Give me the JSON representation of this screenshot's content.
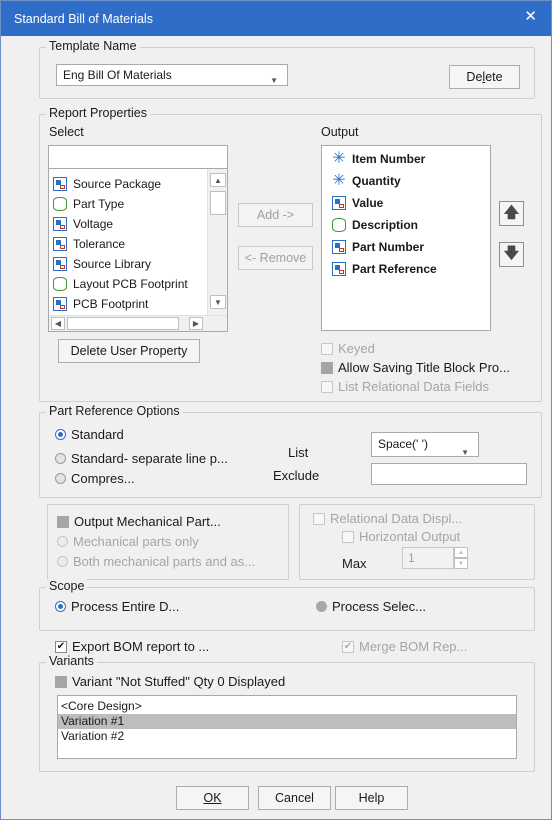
{
  "window": {
    "title": "Standard Bill of Materials",
    "close_icon": "close-icon"
  },
  "template": {
    "group_label": "Template Name",
    "selected": "Eng Bill Of Materials",
    "delete_label_pre": "De",
    "delete_label_u": "l",
    "delete_label_post": "ete"
  },
  "report_properties": {
    "group_label": "Report Properties",
    "select_label": "Select",
    "output_label": "Output",
    "select_items": [
      {
        "label": "Source Package",
        "icon": "property-icon"
      },
      {
        "label": "Part Type",
        "icon": "cylinder-icon"
      },
      {
        "label": "Voltage",
        "icon": "property-icon"
      },
      {
        "label": "Tolerance",
        "icon": "property-icon"
      },
      {
        "label": "Source Library",
        "icon": "property-icon"
      },
      {
        "label": "Layout PCB Footprint",
        "icon": "cylinder-icon"
      },
      {
        "label": "PCB Footprint",
        "icon": "property-icon"
      }
    ],
    "output_items": [
      {
        "label": "Item Number",
        "icon": "asterisk-icon"
      },
      {
        "label": "Quantity",
        "icon": "asterisk-icon"
      },
      {
        "label": "Value",
        "icon": "property-icon"
      },
      {
        "label": "Description",
        "icon": "cylinder-icon"
      },
      {
        "label": "Part Number",
        "icon": "property-icon"
      },
      {
        "label": "Part Reference",
        "icon": "property-icon"
      }
    ],
    "add_label": "Add ->",
    "remove_label": "<- Remove",
    "delete_user_property": "Delete User Property",
    "keyed": "Keyed",
    "allow_saving": "Allow Saving Title Block Pro...",
    "list_relational": "List Relational Data Fields"
  },
  "part_reference": {
    "group_label": "Part Reference Options",
    "standard": "Standard",
    "standard_sep": "Standard- separate line p...",
    "compress": "Compres...",
    "list_label": "List",
    "list_value": "Space(' ')",
    "exclude_label": "Exclude",
    "exclude_value": ""
  },
  "mechanical": {
    "output_mech": "Output Mechanical Part...",
    "mech_only": "Mechanical parts only",
    "both": "Both mechanical parts and as..."
  },
  "relational": {
    "display": "Relational Data Displ...",
    "horizontal": "Horizontal Output",
    "max_label": "Max",
    "max_value": "1"
  },
  "scope": {
    "group_label": "Scope",
    "entire": "Process Entire D...",
    "selection": "Process Selec..."
  },
  "export": {
    "label": "Export BOM report to ...",
    "merge": "Merge BOM Rep..."
  },
  "variants": {
    "group_label": "Variants",
    "not_stuffed": "Variant \"Not Stuffed\" Qty 0 Displayed",
    "items": [
      "<Core Design>",
      "Variation #1",
      "Variation #2"
    ],
    "selected_index": 1
  },
  "footer": {
    "ok": "OK",
    "cancel": "Cancel",
    "help": "Help"
  }
}
